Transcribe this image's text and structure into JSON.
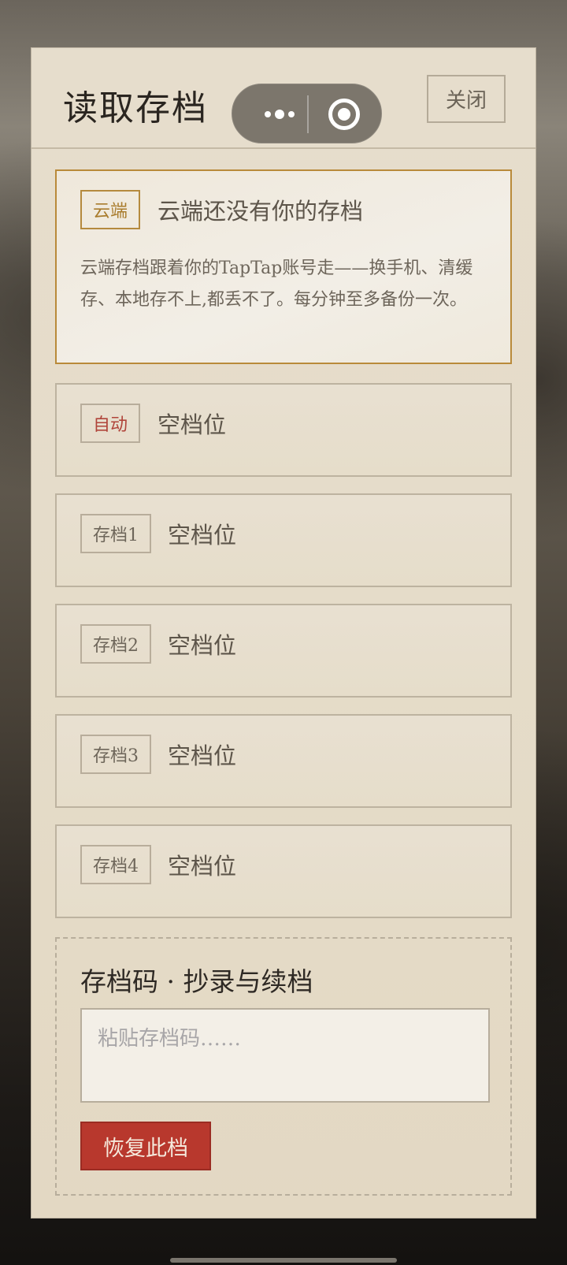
{
  "header": {
    "title": "读取存档",
    "close_label": "关闭"
  },
  "capsule": {
    "more_icon": "more-dots-icon",
    "close_icon": "target-circle-icon"
  },
  "cloud_slot": {
    "tag": "云端",
    "title": "云端还没有你的存档",
    "description": "云端存档跟着你的TapTap账号走——换手机、清缓存、本地存不上,都丢不了。每分钟至多备份一次。"
  },
  "slots": [
    {
      "tag": "自动",
      "title": "空档位"
    },
    {
      "tag": "存档1",
      "title": "空档位"
    },
    {
      "tag": "存档2",
      "title": "空档位"
    },
    {
      "tag": "存档3",
      "title": "空档位"
    },
    {
      "tag": "存档4",
      "title": "空档位"
    }
  ],
  "code_section": {
    "title": "存档码 · 抄录与续档",
    "input_placeholder": "粘贴存档码……",
    "input_value": "",
    "restore_label": "恢复此档"
  },
  "colors": {
    "accent_red": "#b8382d",
    "gold": "#b58a3e",
    "panel_bg": "#e6ddcc"
  }
}
